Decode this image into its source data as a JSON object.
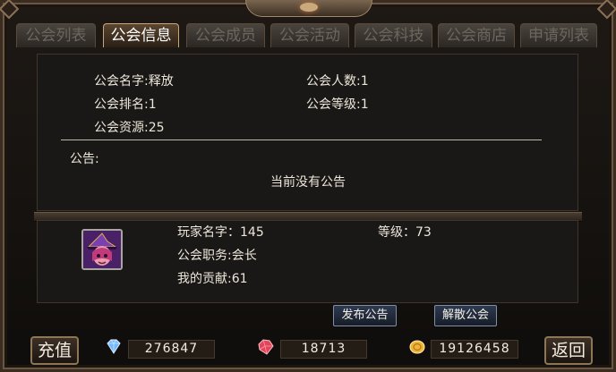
{
  "tabs": [
    {
      "label": "公会列表",
      "active": false
    },
    {
      "label": "公会信息",
      "active": true
    },
    {
      "label": "公会成员",
      "active": false
    },
    {
      "label": "公会活动",
      "active": false
    },
    {
      "label": "公会科技",
      "active": false
    },
    {
      "label": "公会商店",
      "active": false
    },
    {
      "label": "申请列表",
      "active": false
    }
  ],
  "guild": {
    "name": "公会名字:释放",
    "members": "公会人数:1",
    "rank": "公会排名:1",
    "level": "公会等级:1",
    "resources": "公会资源:25"
  },
  "notice": {
    "label": "公告:",
    "content": "当前没有公告"
  },
  "player": {
    "name": "玩家名字：145",
    "level": "等级：73",
    "position": "公会职务:会长",
    "contribution": "我的贡献:61"
  },
  "actions": {
    "publish": "发布公告",
    "disband": "解散公会"
  },
  "footer": {
    "recharge": "充值",
    "back": "返回",
    "diamond": "276847",
    "ruby": "18713",
    "gold": "19126458"
  },
  "colors": {
    "active_tab_border": "#c9a77a",
    "diamond": "#6fb8ff",
    "ruby": "#e0455a",
    "gold": "#f0b43a"
  },
  "icons": {
    "diamond": "blue-diamond-icon",
    "ruby": "red-ruby-icon",
    "gold": "gold-coin-icon",
    "avatar": "witch-hat-avatar"
  }
}
